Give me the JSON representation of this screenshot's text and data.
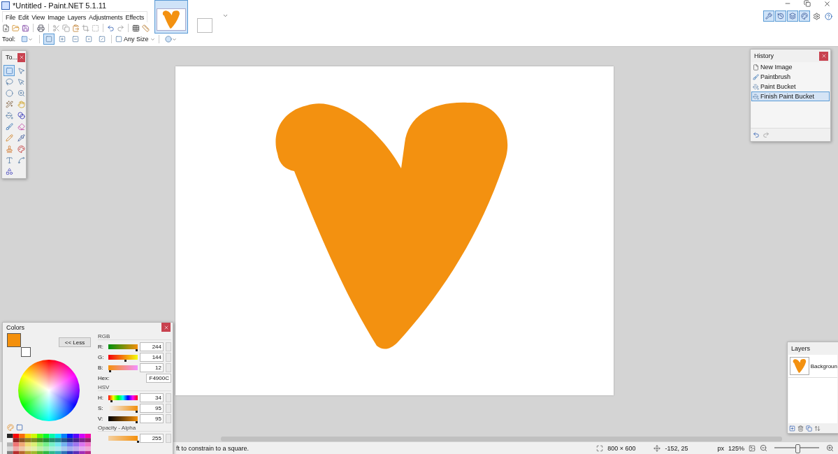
{
  "window": {
    "title": "*Untitled - Paint.NET 5.1.11"
  },
  "menu": [
    "File",
    "Edit",
    "View",
    "Image",
    "Layers",
    "Adjustments",
    "Effects"
  ],
  "image_tabs": [
    {
      "kind": "thumbnail",
      "selected": true
    },
    {
      "kind": "blank",
      "selected": false
    }
  ],
  "dock_toggles": [
    {
      "kind": "tools",
      "on": true
    },
    {
      "kind": "history",
      "on": true
    },
    {
      "kind": "layers",
      "on": true
    },
    {
      "kind": "colors",
      "on": true
    }
  ],
  "tool_options": {
    "label": "Tool:",
    "size": "Any Size",
    "selection_modes": [
      {
        "kind": "replace",
        "selected": true
      },
      {
        "kind": "union",
        "selected": false
      },
      {
        "kind": "exclude",
        "selected": false
      },
      {
        "kind": "intersect",
        "selected": false
      },
      {
        "kind": "xor",
        "selected": false
      }
    ]
  },
  "tools_window": {
    "title": "To...",
    "tools": [
      {
        "kind": "rect-select",
        "selected": true
      },
      {
        "kind": "move-pixels",
        "selected": false
      },
      {
        "kind": "lasso",
        "selected": false
      },
      {
        "kind": "move-selection",
        "selected": false
      },
      {
        "kind": "ellipse",
        "selected": false
      },
      {
        "kind": "zoom",
        "selected": false
      },
      {
        "kind": "wand",
        "selected": false
      },
      {
        "kind": "pan",
        "selected": false
      },
      {
        "kind": "bucket",
        "selected": false
      },
      {
        "kind": "gradient",
        "selected": false
      },
      {
        "kind": "brush",
        "selected": false
      },
      {
        "kind": "eraser",
        "selected": false
      },
      {
        "kind": "pencil",
        "selected": false
      },
      {
        "kind": "picker",
        "selected": false
      },
      {
        "kind": "stamp",
        "selected": false
      },
      {
        "kind": "recolor",
        "selected": false
      },
      {
        "kind": "text",
        "selected": false
      },
      {
        "kind": "line",
        "selected": false
      },
      {
        "kind": "shapes",
        "selected": false
      }
    ]
  },
  "history": {
    "title": "History",
    "items": [
      {
        "kind": "new",
        "label": "New Image",
        "selected": false
      },
      {
        "kind": "brush",
        "label": "Paintbrush",
        "selected": false
      },
      {
        "kind": "bucket",
        "label": "Paint Bucket",
        "selected": false
      },
      {
        "kind": "bucket",
        "label": "Finish Paint Bucket",
        "selected": true
      }
    ]
  },
  "layers": {
    "title": "Layers",
    "items": [
      {
        "name": "Backgroun",
        "selected": false
      }
    ]
  },
  "colors": {
    "title": "Colors",
    "less_button": "<< Less",
    "rgb_heading": "RGB",
    "rgb": [
      {
        "kind": "red",
        "label": "R:",
        "value": "244",
        "level": 0.957
      },
      {
        "kind": "green",
        "label": "G:",
        "value": "144",
        "level": 0.565
      },
      {
        "kind": "blue",
        "label": "B:",
        "value": "12",
        "level": 0.047
      }
    ],
    "hex_label": "Hex:",
    "hex": "F4900C",
    "hsv_heading": "HSV",
    "hsv": [
      {
        "kind": "hue",
        "label": "H:",
        "value": "34",
        "level": 0.094
      },
      {
        "kind": "sat",
        "label": "S:",
        "value": "95",
        "level": 0.95
      },
      {
        "kind": "val",
        "label": "V:",
        "value": "95",
        "level": 0.95
      }
    ],
    "opacity_heading": "Opacity - Alpha",
    "alpha": {
      "value": "255",
      "level": 1
    }
  },
  "status_bar": {
    "hint": "ft to constrain to a square.",
    "size": "800 × 600",
    "position": "-152, 25",
    "unit": "px",
    "zoom": "125%",
    "zoom_slider": {
      "level": 0.5
    }
  }
}
